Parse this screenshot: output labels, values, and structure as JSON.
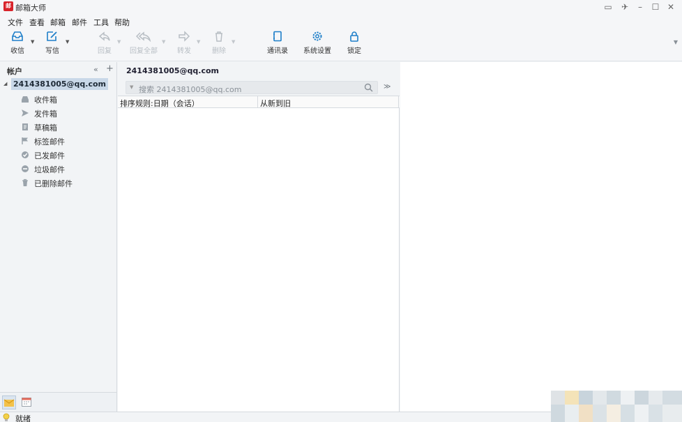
{
  "app": {
    "logo_text": "邮",
    "title": "邮箱大师"
  },
  "window_controls": {
    "feedback": "▭",
    "skin": "✈",
    "minimize": "–",
    "maximize": "☐",
    "close": "✕"
  },
  "menu": [
    "文件",
    "查看",
    "邮箱",
    "邮件",
    "工具",
    "帮助"
  ],
  "toolbar": {
    "receive": "收信",
    "compose": "写信",
    "reply": "回复",
    "reply_all": "回复全部",
    "forward": "转发",
    "delete": "删除",
    "contacts": "通讯录",
    "settings": "系统设置",
    "lock": "锁定",
    "accent_color": "#1e7fc9",
    "disabled_color": "#b8bec4"
  },
  "sidebar": {
    "header": "帐户",
    "collapse_glyph": "«",
    "add_glyph": "+",
    "account": "2414381005@qq.com",
    "folders": [
      {
        "label": "收件箱",
        "icon": "inbox-icon"
      },
      {
        "label": "发件箱",
        "icon": "outbox-icon"
      },
      {
        "label": "草稿箱",
        "icon": "drafts-icon"
      },
      {
        "label": "标签邮件",
        "icon": "flag-icon"
      },
      {
        "label": "已发邮件",
        "icon": "sent-icon"
      },
      {
        "label": "垃圾邮件",
        "icon": "spam-icon"
      },
      {
        "label": "已删除邮件",
        "icon": "trash-icon"
      }
    ]
  },
  "message_list": {
    "title": "2414381005@qq.com",
    "search_placeholder": "搜索 2414381005@qq.com",
    "sort_rule": "排序规则:日期（会话）",
    "sort_order": "从新到旧"
  },
  "status": {
    "text": "就绪"
  }
}
